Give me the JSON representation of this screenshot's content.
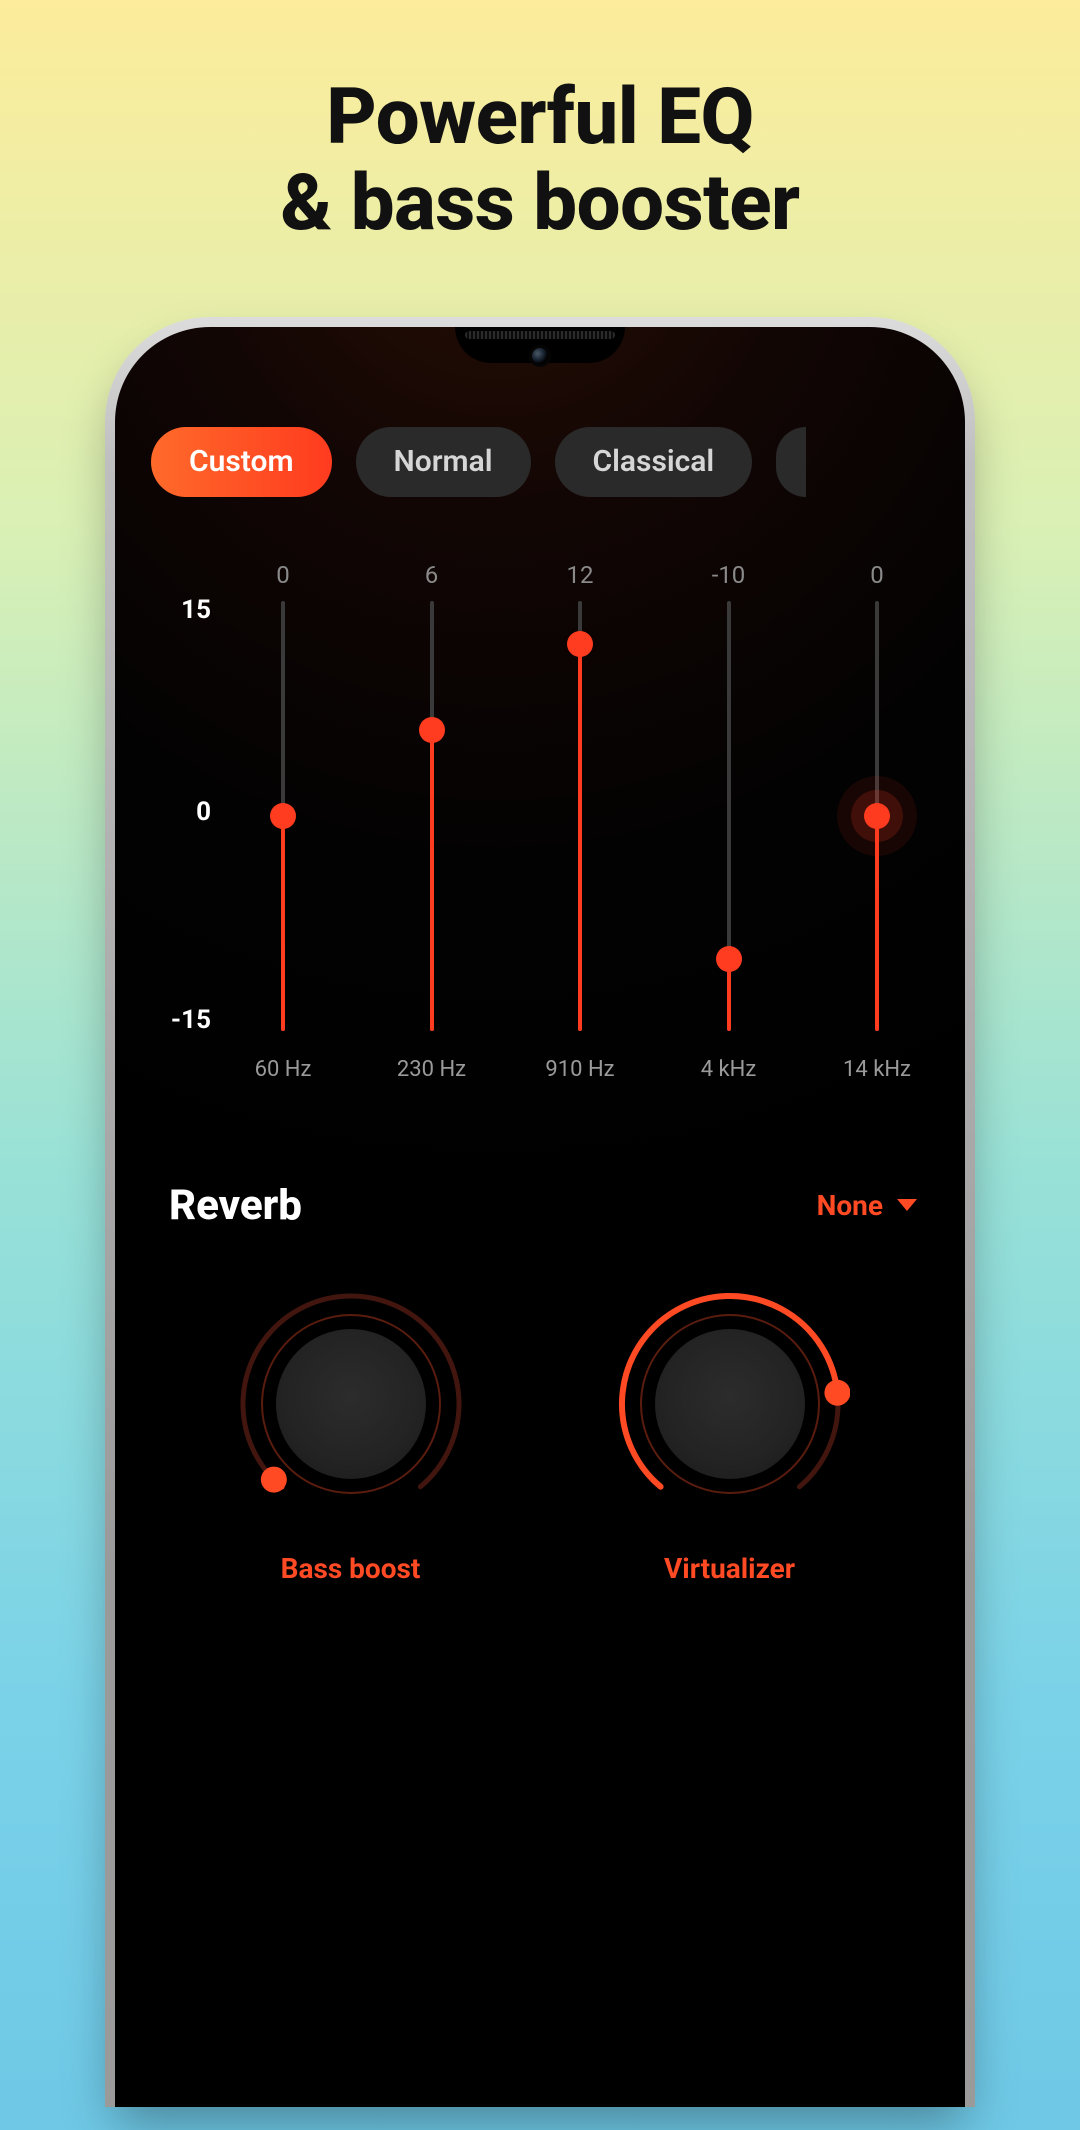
{
  "headline_line1": "Powerful EQ",
  "headline_line2": "& bass booster",
  "presets": {
    "selected": "Custom",
    "others": [
      "Normal",
      "Classical"
    ]
  },
  "axis": {
    "top": "15",
    "mid": "0",
    "bottom": "-15"
  },
  "eq_range": {
    "min": -15,
    "max": 15
  },
  "bands": [
    {
      "value_label": "0",
      "value": 0,
      "freq": "60 Hz",
      "active": false
    },
    {
      "value_label": "6",
      "value": 6,
      "freq": "230 Hz",
      "active": false
    },
    {
      "value_label": "12",
      "value": 12,
      "freq": "910 Hz",
      "active": false
    },
    {
      "value_label": "-10",
      "value": -10,
      "freq": "4 kHz",
      "active": false
    },
    {
      "value_label": "0",
      "value": 0,
      "freq": "14 kHz",
      "active": true
    }
  ],
  "reverb": {
    "title": "Reverb",
    "selected": "None"
  },
  "knobs": {
    "bass": {
      "label": "Bass boost",
      "percent": 2
    },
    "virtualizer": {
      "label": "Virtualizer",
      "percent": 80
    }
  },
  "colors": {
    "accent": "#ff3c1f",
    "accent2": "#ff4a24"
  }
}
